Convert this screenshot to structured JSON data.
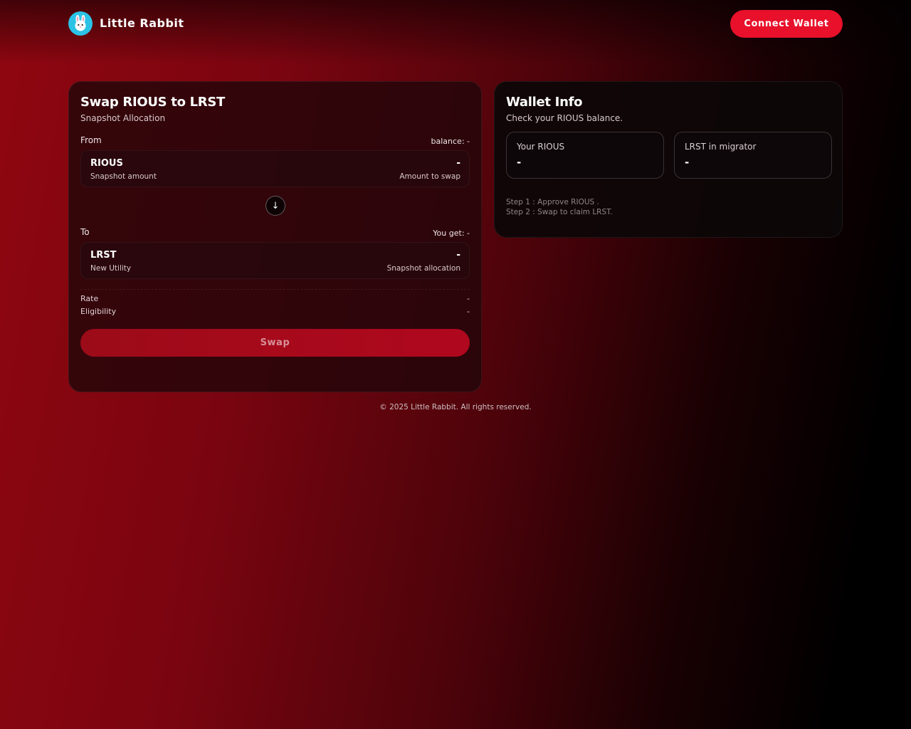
{
  "header": {
    "brand": "Little Rabbit",
    "connect_label": "Connect Wallet"
  },
  "swap": {
    "title": "Swap RIOUS to LRST",
    "subtitle": "Snapshot Allocation",
    "from_label": "From",
    "balance_text": "balance: -",
    "from_token": {
      "name": "RIOUS",
      "desc": "Snapshot amount",
      "value": "-",
      "hint": "Amount to swap"
    },
    "to_label": "To",
    "you_get_text": "You get: -",
    "to_token": {
      "name": "LRST",
      "desc": "New Utility",
      "value": "-",
      "hint": "Snapshot allocation"
    },
    "rate_label": "Rate",
    "rate_value": "-",
    "eligibility_label": "Eligibility",
    "eligibility_value": "-",
    "swap_label": "Swap",
    "arrow_glyph": "↓"
  },
  "wallet": {
    "title": "Wallet Info",
    "subtitle": "Check your RIOUS balance.",
    "your_rious_label": "Your RIOUS",
    "your_rious_value": "-",
    "lrst_migrator_label": "LRST in migrator",
    "lrst_migrator_value": "-",
    "step1": "Step 1 : Approve RIOUS .",
    "step2": "Step 2 : Swap to claim LRST."
  },
  "footer": {
    "text": "© 2025 Little Rabbit. All rights reserved."
  },
  "icons": {
    "logo": "rabbit-icon",
    "swap_direction": "arrow-down-icon"
  },
  "colors": {
    "accent": "#e8102a",
    "swap_button": "#a80a1b",
    "logo_bg": "#2cc2e6"
  }
}
